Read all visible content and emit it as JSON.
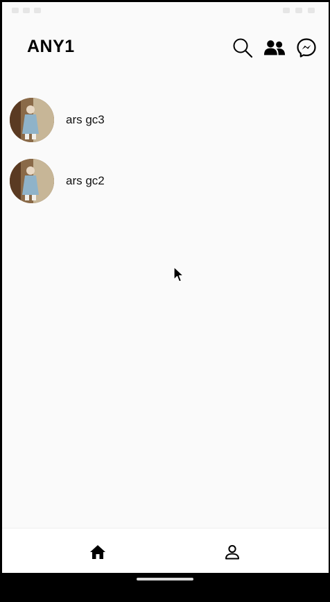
{
  "app_bar": {
    "title": "ANY1",
    "icons": [
      "search-icon",
      "people-icon",
      "messenger-icon"
    ]
  },
  "list": {
    "items": [
      {
        "name": "ars gc3",
        "avatar": "group-avatar"
      },
      {
        "name": "ars gc2",
        "avatar": "group-avatar"
      }
    ]
  },
  "bottom_nav": {
    "items": [
      "home-icon",
      "profile-icon"
    ]
  },
  "colors": {
    "background": "#fafafa",
    "text": "#000000",
    "nav_background": "#ffffff"
  }
}
